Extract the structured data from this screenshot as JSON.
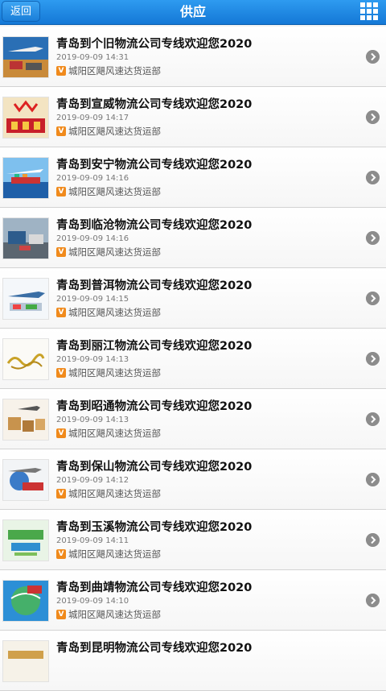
{
  "header": {
    "back_label": "返回",
    "title": "供应",
    "menu_icon": "grid-icon",
    "colors": {
      "bar": "#1a7fd9",
      "text": "#ffffff"
    }
  },
  "items": [
    {
      "title": "青岛到个旧物流公司专线欢迎您2020",
      "date": "2019-09-09 14:31",
      "badge": "V",
      "company": "城阳区飓风速达货运部"
    },
    {
      "title": "青岛到宣威物流公司专线欢迎您2020",
      "date": "2019-09-09 14:17",
      "badge": "V",
      "company": "城阳区飓风速达货运部"
    },
    {
      "title": "青岛到安宁物流公司专线欢迎您2020",
      "date": "2019-09-09 14:16",
      "badge": "V",
      "company": "城阳区飓风速达货运部"
    },
    {
      "title": "青岛到临沧物流公司专线欢迎您2020",
      "date": "2019-09-09 14:16",
      "badge": "V",
      "company": "城阳区飓风速达货运部"
    },
    {
      "title": "青岛到普洱物流公司专线欢迎您2020",
      "date": "2019-09-09 14:15",
      "badge": "V",
      "company": "城阳区飓风速达货运部"
    },
    {
      "title": "青岛到丽江物流公司专线欢迎您2020",
      "date": "2019-09-09 14:13",
      "badge": "V",
      "company": "城阳区飓风速达货运部"
    },
    {
      "title": "青岛到昭通物流公司专线欢迎您2020",
      "date": "2019-09-09 14:13",
      "badge": "V",
      "company": "城阳区飓风速达货运部"
    },
    {
      "title": "青岛到保山物流公司专线欢迎您2020",
      "date": "2019-09-09 14:12",
      "badge": "V",
      "company": "城阳区飓风速达货运部"
    },
    {
      "title": "青岛到玉溪物流公司专线欢迎您2020",
      "date": "2019-09-09 14:11",
      "badge": "V",
      "company": "城阳区飓风速达货运部"
    },
    {
      "title": "青岛到曲靖物流公司专线欢迎您2020",
      "date": "2019-09-09 14:10",
      "badge": "V",
      "company": "城阳区飓风速达货运部"
    },
    {
      "title": "青岛到昆明物流公司专线欢迎您2020",
      "date": "",
      "badge": "",
      "company": ""
    }
  ],
  "colors": {
    "badge": "#f08a1c",
    "arrow": "#8c8c8c"
  }
}
